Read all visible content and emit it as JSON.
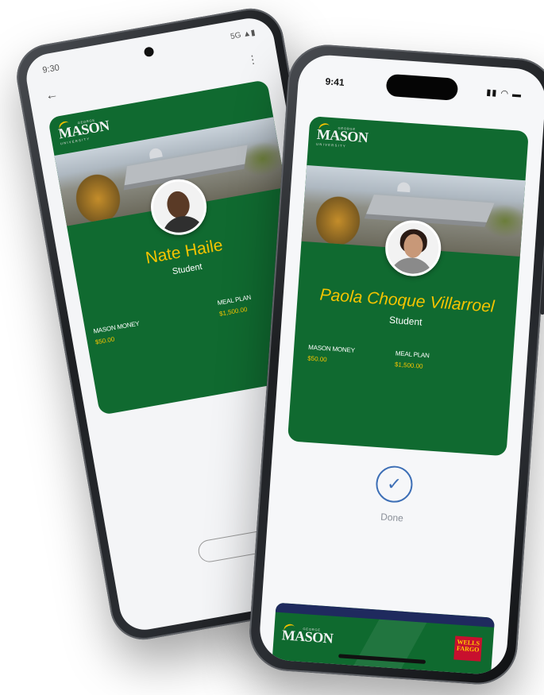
{
  "back_phone": {
    "status": {
      "time": "9:30",
      "network": "5G"
    },
    "card": {
      "logo": {
        "name": "MASON",
        "small": "GEORGE",
        "university": "UNIVERSITY"
      },
      "person_name": "Nate Haile",
      "role": "Student",
      "funds": [
        {
          "label": "MASON MONEY",
          "value": "$50.00"
        },
        {
          "label": "MEAL PLAN",
          "value": "$1,500.00"
        }
      ]
    }
  },
  "front_phone": {
    "status": {
      "time": "9:41"
    },
    "card": {
      "logo": {
        "name": "MASON",
        "small": "GEORGE",
        "university": "UNIVERSITY"
      },
      "person_name": "Paola Choque Villarroel",
      "role": "Student",
      "funds": [
        {
          "label": "MASON MONEY",
          "value": "$50.00"
        },
        {
          "label": "MEAL PLAN",
          "value": "$1,500.00"
        }
      ]
    },
    "done_label": "Done",
    "peek_card": {
      "logo": {
        "name": "MASON",
        "small": "GEORGE"
      },
      "bank": "WELLS FARGO"
    }
  },
  "colors": {
    "mason_green": "#106a30",
    "mason_gold": "#f5c400",
    "done_blue": "#3d6fb6",
    "bank_red": "#c8102e"
  }
}
